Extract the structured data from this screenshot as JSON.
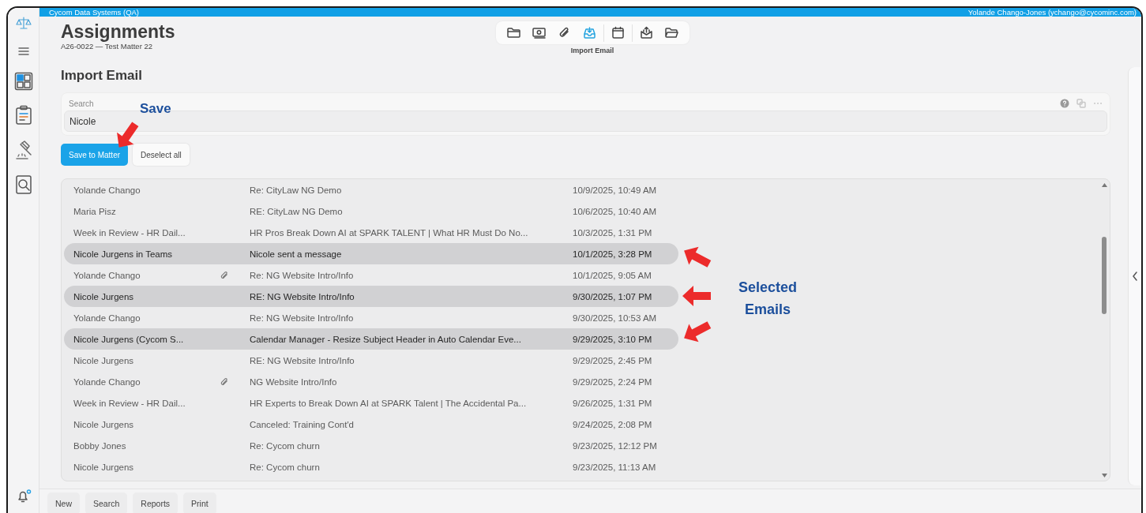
{
  "top_bar": {
    "app_title": "Cycom Data Systems (QA)",
    "user": "Yolande Chango-Jones (ychango@cycominc.com)"
  },
  "header": {
    "title": "Assignments",
    "subtitle": "A26-0022 — Test Matter 22"
  },
  "toolbar": {
    "buttons": [
      {
        "selected": false
      },
      {
        "selected": false
      },
      {
        "selected": false
      },
      {
        "selected": true
      },
      {
        "selected": false
      },
      {
        "selected": false
      },
      {
        "selected": false
      }
    ],
    "caption": "Import Email"
  },
  "section_title": "Import Email",
  "search": {
    "label": "Search",
    "value": "Nicole"
  },
  "actions": [
    {
      "label": "Save to Matter",
      "kind": "primary"
    },
    {
      "label": "Deselect all",
      "kind": "secondary"
    }
  ],
  "emails": [
    {
      "sender": "Yolande Chango",
      "attachment": false,
      "subject": "Re: CityLaw NG Demo",
      "date": "10/9/2025, 10:49 AM",
      "selected": false
    },
    {
      "sender": "Maria Pisz",
      "attachment": false,
      "subject": "RE: CityLaw NG Demo",
      "date": "10/6/2025, 10:40 AM",
      "selected": false
    },
    {
      "sender": "Week in Review - HR Dail...",
      "attachment": false,
      "subject": "HR Pros Break Down AI at SPARK TALENT | What HR Must Do No...",
      "date": "10/3/2025, 1:31 PM",
      "selected": false
    },
    {
      "sender": "Nicole Jurgens in Teams",
      "attachment": false,
      "subject": "Nicole sent a message",
      "date": "10/1/2025, 3:28 PM",
      "selected": true
    },
    {
      "sender": "Yolande Chango",
      "attachment": true,
      "subject": "Re: NG Website Intro/Info",
      "date": "10/1/2025, 9:05 AM",
      "selected": false
    },
    {
      "sender": "Nicole Jurgens",
      "attachment": false,
      "subject": "RE: NG Website Intro/Info",
      "date": "9/30/2025, 1:07 PM",
      "selected": true
    },
    {
      "sender": "Yolande Chango",
      "attachment": false,
      "subject": "Re: NG Website Intro/Info",
      "date": "9/30/2025, 10:53 AM",
      "selected": false
    },
    {
      "sender": "Nicole Jurgens (Cycom S...",
      "attachment": false,
      "subject": "Calendar Manager - Resize Subject Header in Auto Calendar Eve...",
      "date": "9/29/2025, 3:10 PM",
      "selected": true
    },
    {
      "sender": "Nicole Jurgens",
      "attachment": false,
      "subject": "RE: NG Website Intro/Info",
      "date": "9/29/2025, 2:45 PM",
      "selected": false
    },
    {
      "sender": "Yolande Chango",
      "attachment": true,
      "subject": "NG Website Intro/Info",
      "date": "9/29/2025, 2:24 PM",
      "selected": false
    },
    {
      "sender": "Week in Review - HR Dail...",
      "attachment": false,
      "subject": "HR Experts to Break Down AI at SPARK Talent | The Accidental Pa...",
      "date": "9/26/2025, 1:31 PM",
      "selected": false
    },
    {
      "sender": "Nicole Jurgens",
      "attachment": false,
      "subject": "Canceled: Training Cont'd",
      "date": "9/24/2025, 2:08 PM",
      "selected": false
    },
    {
      "sender": "Bobby Jones",
      "attachment": false,
      "subject": "Re: Cycom churn",
      "date": "9/23/2025, 12:12 PM",
      "selected": false
    },
    {
      "sender": "Nicole Jurgens",
      "attachment": false,
      "subject": "Re: Cycom churn",
      "date": "9/23/2025, 11:13 AM",
      "selected": false
    }
  ],
  "bottom_buttons": [
    "New",
    "Search",
    "Reports",
    "Print"
  ],
  "annotations": [
    {
      "text": "Save",
      "kind": "save"
    },
    {
      "text": "Selected Emails",
      "kind": "selected"
    }
  ]
}
